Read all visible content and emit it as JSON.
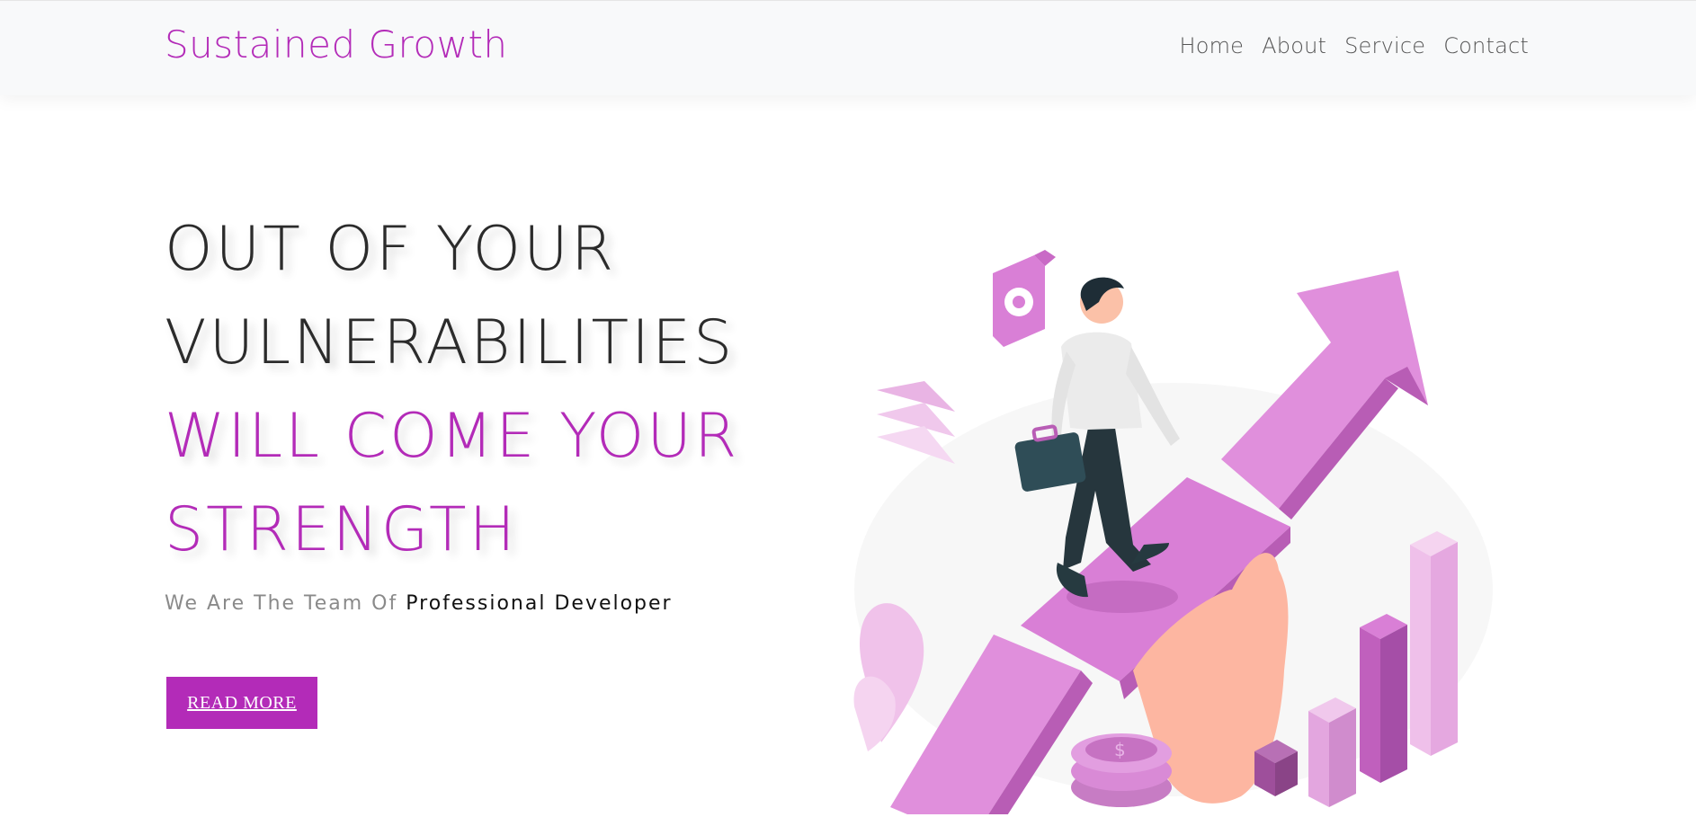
{
  "brand": "Sustained Growth",
  "nav": {
    "items": [
      {
        "label": "Home"
      },
      {
        "label": "About"
      },
      {
        "label": "Service"
      },
      {
        "label": "Contact"
      }
    ]
  },
  "hero": {
    "headline_dark": [
      "OUT OF YOUR",
      "VULNERABILITIES"
    ],
    "headline_accent": [
      "WILL COME YOUR",
      "STRENGTH"
    ],
    "tagline_muted": "We Are The Team Of ",
    "tagline_strong": "Professional Developer",
    "cta_label": "READ MORE"
  },
  "illustration": {
    "icon": "growth-illustration"
  },
  "colors": {
    "accent": "#b32bb8",
    "accent_light": "#e08fdc",
    "accent_dark": "#a54ea7",
    "text_dark": "#2b2b2b",
    "text_muted": "#8a8a8a",
    "navbar_bg": "#f8f9fa"
  }
}
